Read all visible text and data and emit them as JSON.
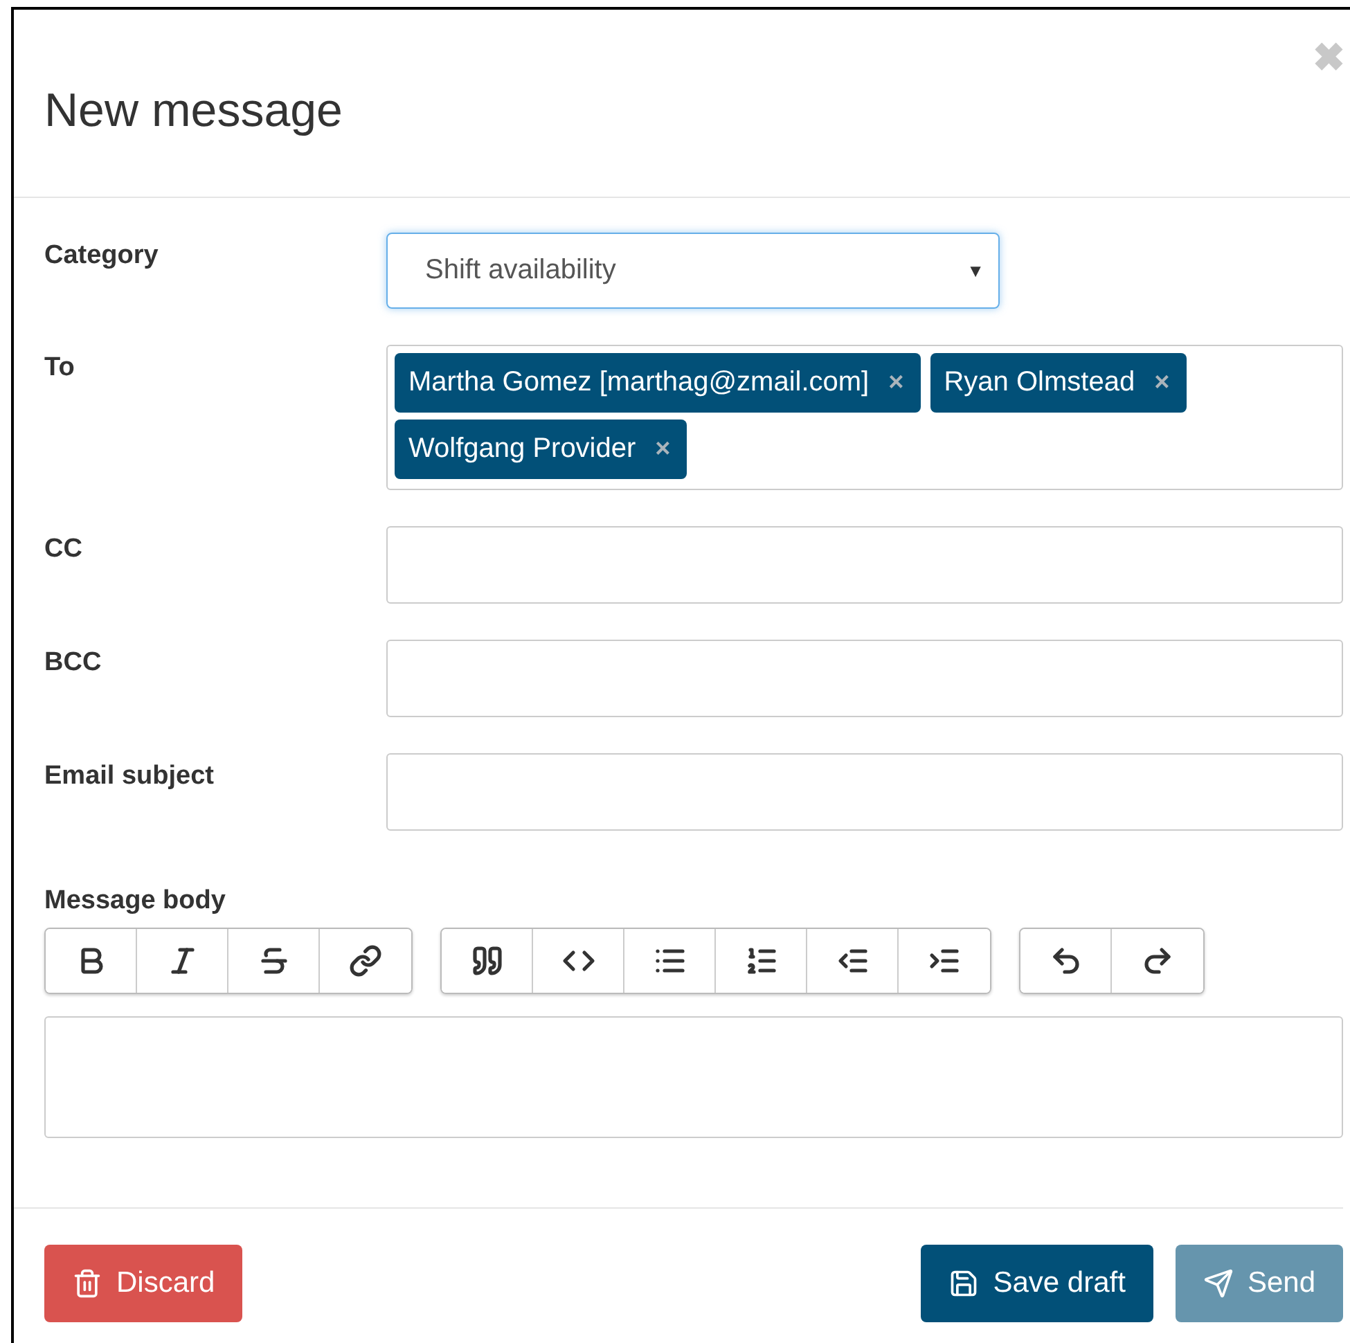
{
  "dialog": {
    "title": "New message",
    "close": "✖"
  },
  "fields": [
    {
      "kind": "select",
      "label": "Category",
      "value": "Shift availability",
      "caret": "▼",
      "focused": true
    },
    {
      "kind": "tags",
      "label": "To",
      "tags": [
        {
          "text": "Martha Gomez [marthag@zmail.com]",
          "remove": "×"
        },
        {
          "text": "Ryan Olmstead",
          "remove": "×"
        },
        {
          "text": "Wolfgang Provider",
          "remove": "×"
        }
      ]
    },
    {
      "kind": "text",
      "label": "CC"
    },
    {
      "kind": "text",
      "label": "BCC"
    },
    {
      "kind": "text",
      "label": "Email subject"
    }
  ],
  "body": {
    "label": "Message body",
    "toolbar": [
      {
        "buttons": [
          {
            "kind": "bold"
          },
          {
            "kind": "italic"
          },
          {
            "kind": "strikethrough"
          },
          {
            "kind": "link"
          }
        ]
      },
      {
        "buttons": [
          {
            "kind": "quote"
          },
          {
            "kind": "code"
          },
          {
            "kind": "bullets"
          },
          {
            "kind": "numbers"
          },
          {
            "kind": "outdent"
          },
          {
            "kind": "indent"
          }
        ]
      },
      {
        "buttons": [
          {
            "kind": "undo"
          },
          {
            "kind": "redo"
          }
        ]
      }
    ]
  },
  "buttons": [
    {
      "kind": "discard",
      "label": "Discard",
      "disabled": false
    },
    {
      "kind": "save",
      "label": "Save draft",
      "disabled": false
    },
    {
      "kind": "send",
      "label": "Send",
      "disabled": true
    }
  ]
}
